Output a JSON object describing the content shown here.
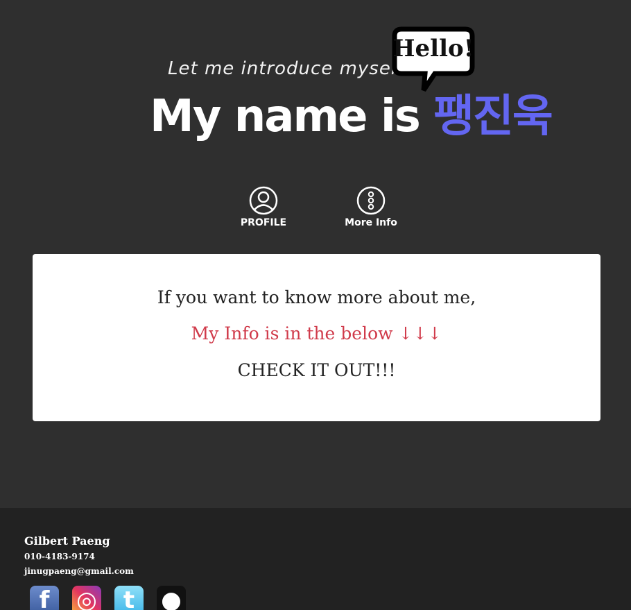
{
  "hero": {
    "intro": "Let me introduce myself",
    "bubble": "Hello!",
    "name_prefix": "My name is ",
    "name_korean": "팽진욱"
  },
  "nav": [
    {
      "label": "PROFILE",
      "icon": "user-circle-icon"
    },
    {
      "label": "More Info",
      "icon": "more-dots-icon"
    }
  ],
  "card": {
    "line1": "If you want to know more about me,",
    "line2": "My Info is in the below ↓↓↓",
    "line3": "CHECK IT OUT!!!"
  },
  "footer": {
    "name": "Gilbert Paeng",
    "phone": "010-4183-9174",
    "email": "jinugpaeng@gmail.com"
  },
  "social": [
    {
      "icon": "facebook-icon",
      "glyph": "f",
      "color": "#3b5b9d"
    },
    {
      "icon": "instagram-icon",
      "glyph": "◎",
      "color": "#e3355f"
    },
    {
      "icon": "twitter-icon",
      "glyph": "t",
      "color": "#3fb6e8"
    },
    {
      "icon": "github-icon",
      "glyph": "●",
      "color": "#111111"
    }
  ],
  "colors": {
    "background": "#2f2f2f",
    "footer": "#222222",
    "accent_korean": "#6366f1",
    "accent_red": "#d03a4a"
  }
}
